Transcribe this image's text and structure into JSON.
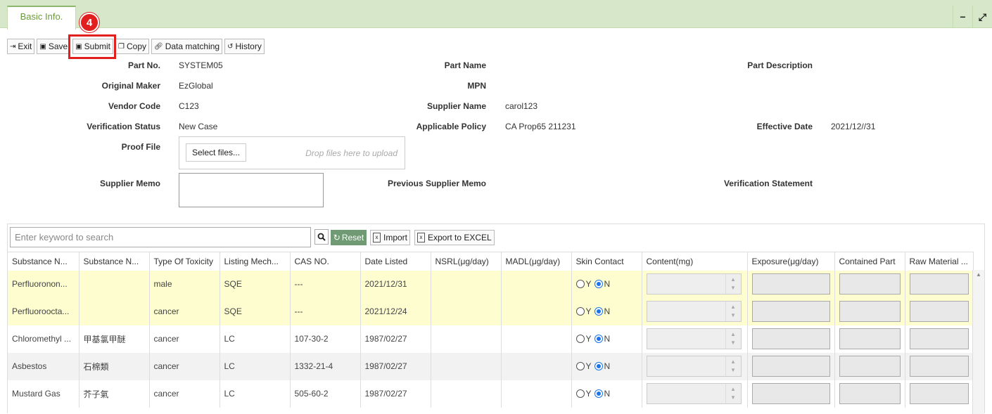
{
  "tabs": [
    {
      "label": "Basic Info."
    }
  ],
  "window_controls": {
    "minimize": "−",
    "expand": "⤢"
  },
  "step_badge": "4",
  "toolbar": {
    "exit": "Exit",
    "save": "Save",
    "submit": "Submit",
    "copy": "Copy",
    "data_matching": "Data matching",
    "history": "History"
  },
  "form": {
    "part_no_label": "Part No.",
    "part_no": "SYSTEM05",
    "part_name_label": "Part Name",
    "part_desc_label": "Part Description",
    "original_maker_label": "Original Maker",
    "original_maker": "EzGlobal",
    "mpn_label": "MPN",
    "vendor_code_label": "Vendor Code",
    "vendor_code": "C123",
    "supplier_name_label": "Supplier Name",
    "supplier_name": "carol123",
    "verification_status_label": "Verification Status",
    "verification_status": "New Case",
    "applicable_policy_label": "Applicable Policy",
    "applicable_policy": "CA Prop65 211231",
    "effective_date_label": "Effective Date",
    "effective_date": "2021/12//31",
    "proof_file_label": "Proof File",
    "select_files": "Select files...",
    "drop_hint": "Drop files here to upload",
    "supplier_memo_label": "Supplier Memo",
    "prev_supplier_memo_label": "Previous Supplier Memo",
    "verification_statement_label": "Verification Statement"
  },
  "grid": {
    "search_placeholder": "Enter keyword to search",
    "reset": "Reset",
    "import": "Import",
    "export": "Export to EXCEL",
    "columns": [
      "Substance N...",
      "Substance N...",
      "Type Of Toxicity",
      "Listing Mech...",
      "CAS NO.",
      "Date Listed",
      "NSRL(μg/day)",
      "MADL(μg/day)",
      "Skin Contact",
      "Content(mg)",
      "Exposure(μg/day)",
      "Contained Part",
      "Raw Material ..."
    ],
    "radio_y": "Y",
    "radio_n": "N",
    "rows": [
      {
        "c0": "Perfluoronon...",
        "c1": "",
        "c2": "male",
        "c3": "SQE",
        "c4": "---",
        "c5": "2021/12/31",
        "c6": "",
        "c7": ""
      },
      {
        "c0": "Perfluoroocta...",
        "c1": "",
        "c2": "cancer",
        "c3": "SQE",
        "c4": "---",
        "c5": "2021/12/24",
        "c6": "",
        "c7": ""
      },
      {
        "c0": "Chloromethyl ...",
        "c1": "甲基氯甲醚",
        "c2": "cancer",
        "c3": "LC",
        "c4": "107-30-2",
        "c5": "1987/02/27",
        "c6": "",
        "c7": ""
      },
      {
        "c0": "Asbestos",
        "c1": "石棉類",
        "c2": "cancer",
        "c3": "LC",
        "c4": "1332-21-4",
        "c5": "1987/02/27",
        "c6": "",
        "c7": ""
      },
      {
        "c0": "Mustard Gas",
        "c1": "芥子氣",
        "c2": "cancer",
        "c3": "LC",
        "c4": "505-60-2",
        "c5": "1987/02/27",
        "c6": "",
        "c7": ""
      }
    ]
  }
}
